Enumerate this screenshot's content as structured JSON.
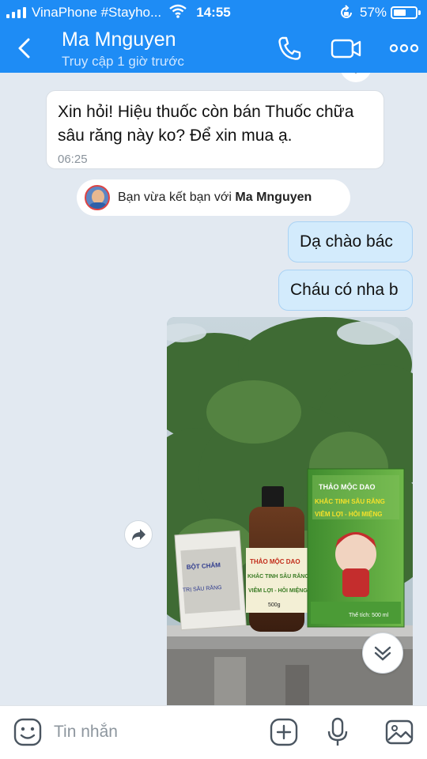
{
  "status_bar": {
    "carrier": "VinaPhone #Stayho...",
    "time": "14:55",
    "battery_pct": "57%",
    "battery_level": 0.57
  },
  "header": {
    "contact_name": "Ma Mnguyen",
    "contact_status": "Truy cập 1 giờ trước",
    "icons": [
      "back-icon",
      "phone-icon",
      "video-camera-icon",
      "more-icon"
    ]
  },
  "chat": {
    "incoming": {
      "text": "Xin hỏi! Hiệu thuốc còn bán Thuốc chữa sâu răng này ko? Để xin mua ạ.",
      "time": "06:25"
    },
    "system": {
      "prefix": "Bạn vừa kết bạn với ",
      "name": "Ma Mnguyen"
    },
    "outgoing": [
      {
        "text": "Dạ chào bác"
      },
      {
        "text": "Cháu có nha b"
      }
    ],
    "photo": {
      "small_pack_label": "BỘT CHẤM TRỊ SÂU RĂNG - VIÊM LỢI",
      "bottle_label": [
        "THẢO MỘC DAO",
        "KHẮC TINH SÂU RĂNG",
        "VIÊM LỢI - HÔI MIỆNG",
        "500g"
      ],
      "box_label": [
        "THẢO MỘC DAO",
        "KHẮC TINH SÂU RĂNG",
        "VIÊM LỢI - HÔI MIỆNG",
        "Thể tích: 500 ml"
      ]
    }
  },
  "composer": {
    "placeholder": "Tin nhắn",
    "icons": [
      "emoji-icon",
      "add-icon",
      "microphone-icon",
      "image-icon"
    ]
  },
  "colors": {
    "header_bg": "#1e8cf5",
    "outgoing_bubble": "#d3ebfc",
    "chat_bg": "#e2e9f1"
  }
}
